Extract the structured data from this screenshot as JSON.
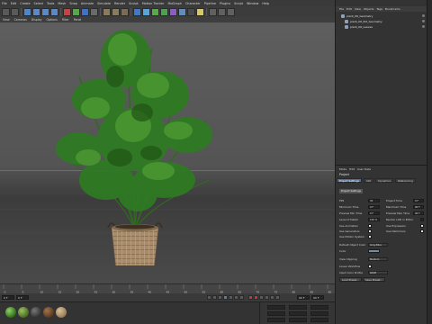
{
  "menubar": {
    "items": [
      "File",
      "Edit",
      "Create",
      "Select",
      "Tools",
      "Mesh",
      "Snap",
      "Animate",
      "Simulate",
      "Render",
      "Sculpt",
      "Motion Tracker",
      "MoGraph",
      "Character",
      "Pipeline",
      "Plugins",
      "Script",
      "Window",
      "Help"
    ]
  },
  "viewport": {
    "menus": [
      "View",
      "Cameras",
      "Display",
      "Options",
      "Filter",
      "Panel"
    ]
  },
  "timeline": {
    "ticks": [
      "0",
      "5",
      "10",
      "15",
      "20",
      "25",
      "30",
      "35",
      "40",
      "45",
      "50",
      "55",
      "60",
      "65",
      "70",
      "75",
      "80",
      "85",
      "90"
    ],
    "end_label": "90 F"
  },
  "playbar": {
    "start_frame": "0 F",
    "current_frame": "0 F",
    "end_frame": "90 F",
    "max_frame": "90 F"
  },
  "materials": {
    "count": 5
  },
  "object_manager": {
    "menus": [
      "File",
      "Edit",
      "View",
      "Objects",
      "Tags",
      "Bookmarks"
    ],
    "rows": [
      {
        "name": "plant_06_Geometry",
        "indent": 0
      },
      {
        "name": "plant_06_Pot_Geometry",
        "indent": 1
      },
      {
        "name": "plant_06_Leaves",
        "indent": 1
      }
    ]
  },
  "attribute_manager": {
    "menus": [
      "Mode",
      "Edit",
      "User Data"
    ],
    "title": "Project",
    "tabs": [
      "Project Settings",
      "Info",
      "Dynamics",
      "Referencing"
    ],
    "section": "Project Settings",
    "fields": {
      "fps_label": "FPS",
      "fps_value": "30",
      "project_time_label": "Project Time",
      "project_time_value": "0 F",
      "min_time_label": "Minimum Time",
      "min_time_value": "0 F",
      "max_time_label": "Maximum Time",
      "max_time_value": "90 F",
      "preview_min_label": "Preview Min Time",
      "preview_min_value": "0 F",
      "preview_max_label": "Preview Max Time",
      "preview_max_value": "90 F",
      "lod_label": "Level of Detail",
      "lod_value": "100 %",
      "render_lod_label": "Render LOD in Editor",
      "use_animation_label": "Use Animation",
      "use_expression_label": "Use Expression",
      "use_generators_label": "Use Generators",
      "use_deformers_label": "Use Deformers",
      "use_motion_label": "Use Motion System",
      "default_color_label": "Default Object Color",
      "default_color_value": "Gray-Blue",
      "color_label": "Color",
      "view_clipping_label": "View Clipping",
      "view_clipping_value": "Medium",
      "linear_workflow_label": "Linear Workflow",
      "input_color_label": "Input Color Profile",
      "input_color_value": "sRGB",
      "load_preset_label": "Load Preset...",
      "save_preset_label": "Save Preset..."
    }
  }
}
